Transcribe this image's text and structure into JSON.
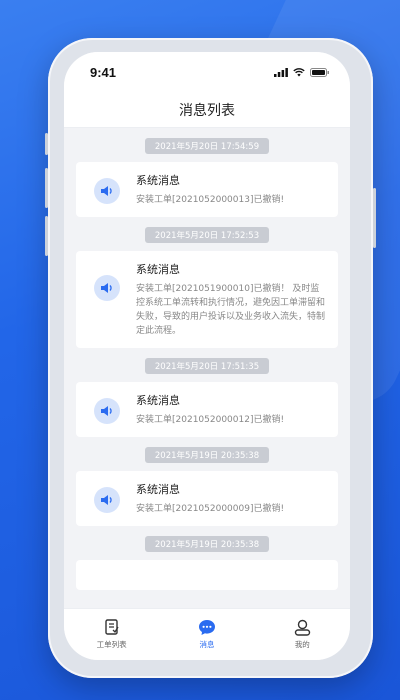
{
  "status_bar": {
    "time": "9:41"
  },
  "header": {
    "title": "消息列表"
  },
  "messages": [
    {
      "timestamp": "2021年5月20日  17:54:59",
      "title": "系统消息",
      "text": "安装工单[2021052000013]已撤销!"
    },
    {
      "timestamp": "2021年5月20日  17:52:53",
      "title": "系统消息",
      "text": "安装工单[2021051900010]已撤销！ 及时监控系统工单流转和执行情况，避免因工单滞留和失败，导致的用户投诉以及业务收入流失，特制定此流程。"
    },
    {
      "timestamp": "2021年5月20日  17:51:35",
      "title": "系统消息",
      "text": "安装工单[2021052000012]已撤销!"
    },
    {
      "timestamp": "2021年5月19日  20:35:38",
      "title": "系统消息",
      "text": "安装工单[2021052000009]已撤销!"
    },
    {
      "timestamp": "2021年5月19日  20:35:38"
    }
  ],
  "tabbar": {
    "tabs": [
      {
        "label": "工单列表",
        "icon": "document-icon"
      },
      {
        "label": "消息",
        "icon": "chat-icon",
        "active": true
      },
      {
        "label": "我的",
        "icon": "user-icon"
      }
    ]
  },
  "colors": {
    "accent": "#2a6bf0",
    "icon_bg": "#d6e3fb",
    "time_pill": "#c9ccd3"
  }
}
